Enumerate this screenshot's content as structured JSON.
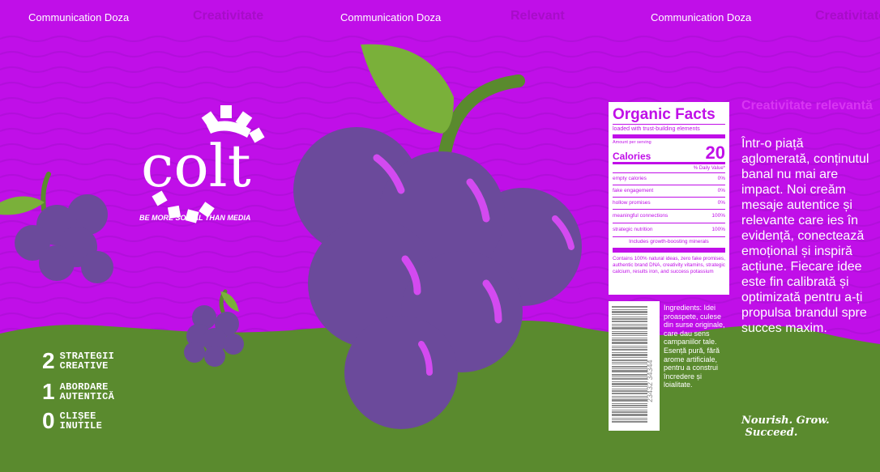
{
  "ticker": [
    {
      "text": "Communication Doza",
      "style": "white"
    },
    {
      "text": "Creativitate",
      "style": "faint"
    },
    {
      "text": "Communication Doza",
      "style": "white"
    },
    {
      "text": "Relevant",
      "style": "faint"
    },
    {
      "text": "Communication Doza",
      "style": "white"
    },
    {
      "text": "Creativitate",
      "style": "faint"
    }
  ],
  "logo": {
    "word": "colt",
    "slogan": "BE MORE SOCIAL THAN MEDIA"
  },
  "stats": [
    {
      "num": "2",
      "label_1": "STRATEGII",
      "label_2": "CREATIVE"
    },
    {
      "num": "1",
      "label_1": "ABORDARE",
      "label_2": "AUTENTICĂ"
    },
    {
      "num": "0",
      "label_1": "CLIȘEE",
      "label_2": "INUTILE"
    }
  ],
  "facts": {
    "title": "Organic Facts",
    "subtitle": "loaded with trust-building elements",
    "amount_per_serving": "Amount per serving",
    "calories_label": "Calories",
    "calories_value": "20",
    "daily_value": "% Daily Value*",
    "rows": [
      {
        "label": "empty calories",
        "value": "0%"
      },
      {
        "label": "fake engagement",
        "value": "0%"
      },
      {
        "label": "hollow promises",
        "value": "0%"
      },
      {
        "label": "meaningful connections",
        "value": "100%"
      },
      {
        "label": "strategic nutrition",
        "value": "100%"
      }
    ],
    "includes": "Includes growth-boosting minerals",
    "footer": "Contains 100% natural ideas, zero fake promises, authentic brand DNA, creativity vitamins, strategic calcium, results iron, and success potassium"
  },
  "barcode_number": "23432 34344",
  "ingredients": "Ingredients: Idei proaspete, culese din surse originale, care dau sens campaniilor tale. Esență pură, fără arome artificiale, pentru a construi încredere și loialitate.",
  "side": {
    "title": "Creativitate relevantă",
    "body": "Într-o piață aglomerată, conținutul banal nu mai are impact. Noi creăm mesaje autentice și relevante care ies în evidență, conectează emoțional și inspiră acțiune. Fiecare idee este fin calibrată și optimizată pentru a-ți propulsa brandul spre succes maxim.",
    "tagline_1": "Nourish. Grow.",
    "tagline_2": "Succeed."
  },
  "colors": {
    "background": "#c00fe8",
    "wave": "#b20fdb",
    "grass": "#5a8a2e",
    "grape": "#6b4a9b",
    "leaf": "#7ab03a",
    "stem": "#5a8a2e",
    "text_on_bg": "#ffffff"
  }
}
